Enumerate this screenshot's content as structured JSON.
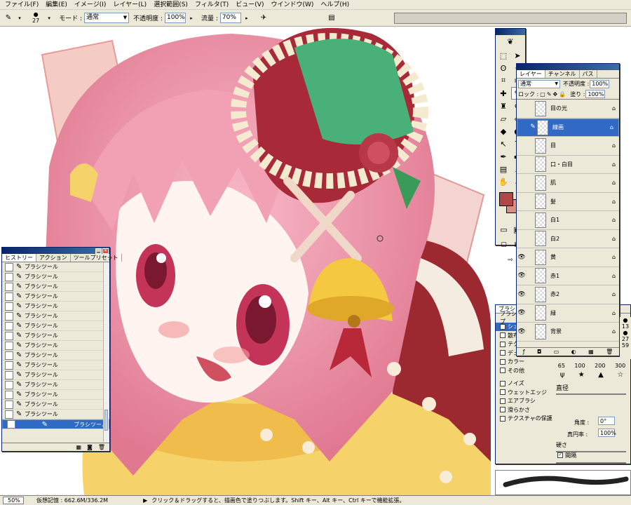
{
  "menubar": {
    "items": [
      "ファイル(F)",
      "編集(E)",
      "イメージ(I)",
      "レイヤー(L)",
      "選択範囲(S)",
      "フィルタ(T)",
      "ビュー(V)",
      "ウインドウ(W)",
      "ヘルプ(H)"
    ]
  },
  "options": {
    "brush_size": "27",
    "mode_label": "モード :",
    "mode_value": "通常",
    "opacity_label": "不透明度 :",
    "opacity_value": "100%",
    "flow_label": "流量 :",
    "flow_value": "70%"
  },
  "tools": {
    "icons": [
      "marquee-icon",
      "move-icon",
      "lasso-icon",
      "magic-wand-icon",
      "crop-icon",
      "slice-icon",
      "healing-icon",
      "brush-icon",
      "stamp-icon",
      "history-brush-icon",
      "eraser-icon",
      "bucket-icon",
      "blur-icon",
      "dodge-icon",
      "path-select-icon",
      "type-icon",
      "pen-icon",
      "shape-icon",
      "notes-icon",
      "eyedropper-icon",
      "hand-icon",
      "zoom-icon"
    ],
    "fg_color": "#b04848",
    "bg_color": "#d89080"
  },
  "history": {
    "tabs": [
      "ヒストリー",
      "アクション",
      "ツールプリセット"
    ],
    "items": [
      "ブラシツール",
      "ブラシツール",
      "ブラシツール",
      "ブラシツール",
      "ブラシツール",
      "ブラシツール",
      "ブラシツール",
      "ブラシツール",
      "ブラシツール",
      "ブラシツール",
      "ブラシツール",
      "ブラシツール",
      "ブラシツール",
      "ブラシツール",
      "ブラシツール",
      "ブラシツール",
      "ブラシツール"
    ]
  },
  "layers": {
    "tabs": [
      "レイヤー",
      "チャンネル",
      "パス"
    ],
    "mode": "通常",
    "opacity_label": "不透明度 :",
    "opacity_value": "100%",
    "lock_label": "ロック :",
    "fill_label": "塗り :",
    "fill_value": "100%",
    "items": [
      {
        "name": "目の光",
        "visible": false
      },
      {
        "name": "線画",
        "visible": false
      },
      {
        "name": "目",
        "visible": false
      },
      {
        "name": "口・白目",
        "visible": false
      },
      {
        "name": "肌",
        "visible": false
      },
      {
        "name": "髪",
        "visible": false
      },
      {
        "name": "白1",
        "visible": false
      },
      {
        "name": "白2",
        "visible": false
      },
      {
        "name": "黄",
        "visible": true
      },
      {
        "name": "赤1",
        "visible": true
      },
      {
        "name": "赤2",
        "visible": true
      },
      {
        "name": "緑",
        "visible": true
      },
      {
        "name": "背景",
        "visible": true
      }
    ]
  },
  "brushes": {
    "tab": "ブラシ",
    "sizes": [
      "65",
      "100",
      "200",
      "300"
    ],
    "side_sizes": [
      "13",
      "27",
      "59"
    ],
    "options": [
      {
        "label": "ブラシ先端のシェイプ",
        "checked": false
      },
      {
        "label": "シェイプ",
        "checked": true
      },
      {
        "label": "散布",
        "checked": false
      },
      {
        "label": "テクスチャ",
        "checked": false
      },
      {
        "label": "デュアルブラシ",
        "checked": false
      },
      {
        "label": "カラー",
        "checked": false
      },
      {
        "label": "その他",
        "checked": false
      },
      {
        "label": "ノイズ",
        "checked": false
      },
      {
        "label": "ウェットエッジ",
        "checked": false
      },
      {
        "label": "エアブラシ",
        "checked": false
      },
      {
        "label": "滑らかさ",
        "checked": false
      },
      {
        "label": "テクスチャの保護",
        "checked": false
      }
    ],
    "diameter_label": "直径",
    "angle_label": "角度 :",
    "angle_value": "0°",
    "roundness_label": "真円率 :",
    "roundness_value": "100%",
    "hardness_label": "硬さ",
    "spacing_label": "間隔"
  },
  "status": {
    "zoom": "50%",
    "memory": "仮想記憶 : 662.6M/336.2M",
    "hint": "クリック＆ドラッグすると、描画色で塗りつぶします。Shift キー、Alt キー、Ctrl キーで機能拡張。"
  },
  "colors": {
    "title_blue": "#0a246a",
    "select_blue": "#316ac5",
    "panel": "#ece9d8"
  }
}
